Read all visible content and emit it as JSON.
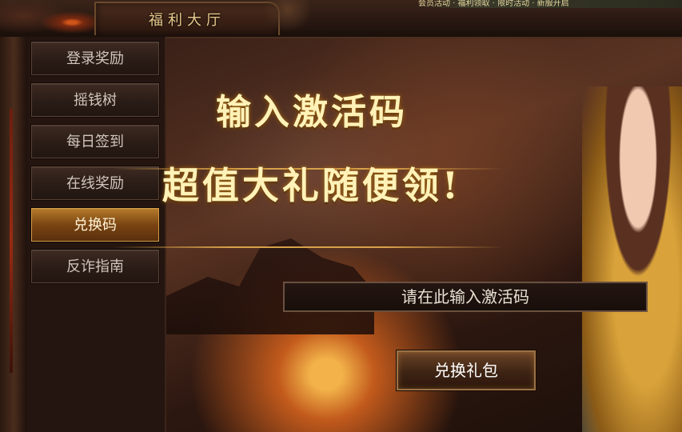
{
  "window": {
    "title": "福利大厅",
    "ticker": "会员活动 · 福利领取 · 限时活动 · 新服开启"
  },
  "sidebar": {
    "items": [
      {
        "label": "登录奖励",
        "active": false
      },
      {
        "label": "摇钱树",
        "active": false
      },
      {
        "label": "每日签到",
        "active": false
      },
      {
        "label": "在线奖励",
        "active": false
      },
      {
        "label": "兑换码",
        "active": true
      },
      {
        "label": "反诈指南",
        "active": false
      }
    ]
  },
  "main": {
    "headline": "输入激活码",
    "subheadline": "超值大礼随便领!",
    "code_placeholder": "请在此输入激活码",
    "code_value": "",
    "redeem_label": "兑换礼包"
  },
  "colors": {
    "accent_gold": "#d8a24a",
    "active_tab": "#b57a2a",
    "panel_bg": "#241510"
  }
}
